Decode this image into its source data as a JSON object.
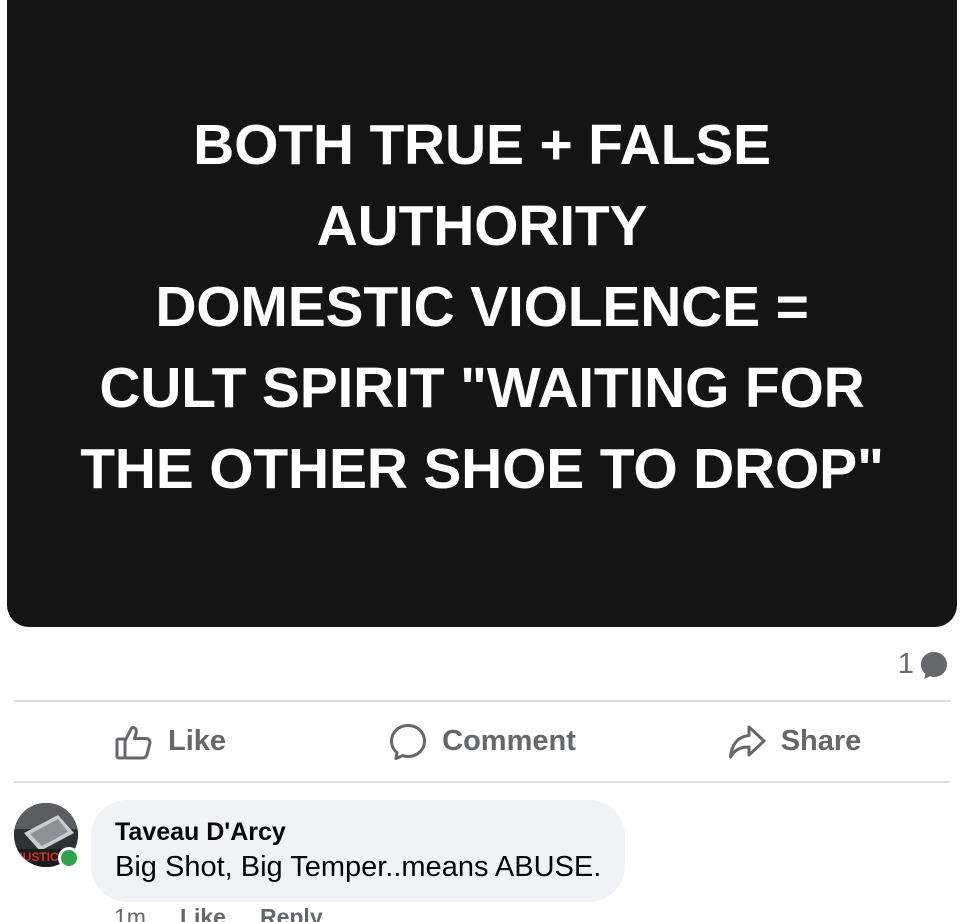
{
  "post": {
    "text_lines": [
      "BOTH TRUE + FALSE",
      "AUTHORITY",
      "DOMESTIC VIOLENCE =",
      "CULT SPIRIT \"WAITING FOR",
      "THE OTHER SHOE TO DROP\""
    ],
    "background_color": "#141414",
    "text_color": "#ffffff"
  },
  "stats": {
    "comment_count": "1",
    "icon": "comment-bubble-icon"
  },
  "actions": {
    "like_label": "Like",
    "like_icon": "thumbs-up-icon",
    "comment_label": "Comment",
    "comment_icon": "comment-icon",
    "share_label": "Share",
    "share_icon": "share-arrow-icon"
  },
  "comment": {
    "author": "Taveau D'Arcy",
    "text": "Big Shot, Big Temper..means ABUSE.",
    "time": "1m",
    "like_label": "Like",
    "reply_label": "Reply",
    "online_status_color": "#31a24c"
  },
  "colors": {
    "secondary_text": "#65676b",
    "divider": "#dadde1",
    "bubble": "#f0f2f5"
  }
}
